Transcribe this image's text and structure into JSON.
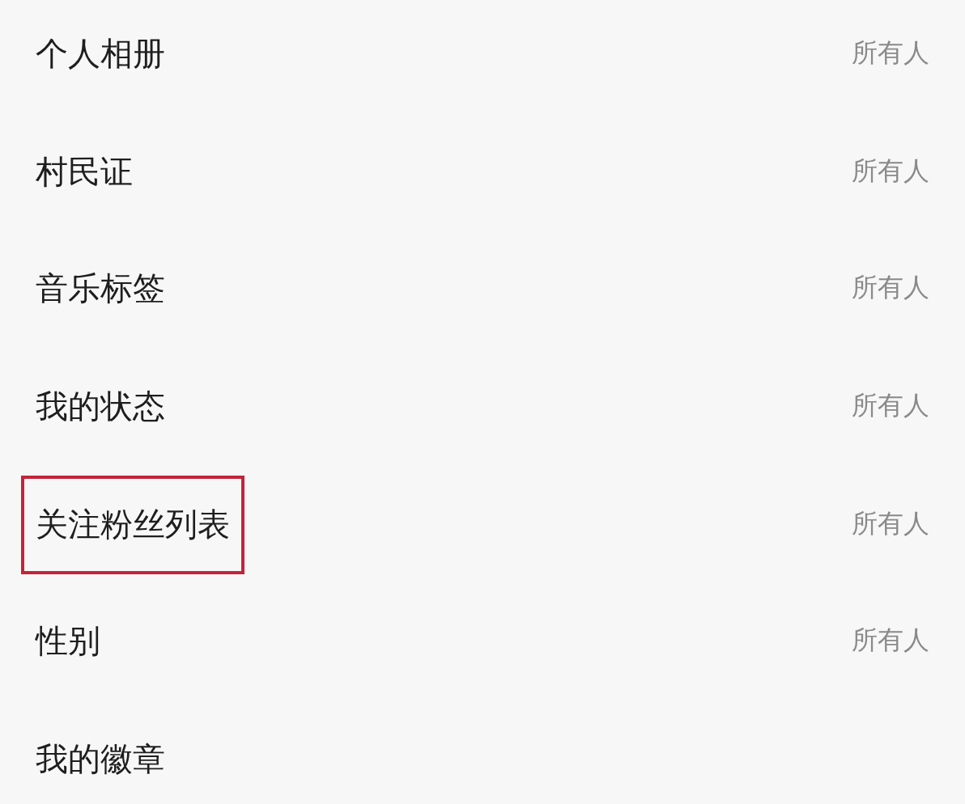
{
  "settings": [
    {
      "label": "个人相册",
      "value": "所有人",
      "highlighted": false
    },
    {
      "label": "村民证",
      "value": "所有人",
      "highlighted": false
    },
    {
      "label": "音乐标签",
      "value": "所有人",
      "highlighted": false
    },
    {
      "label": "我的状态",
      "value": "所有人",
      "highlighted": false
    },
    {
      "label": "关注粉丝列表",
      "value": "所有人",
      "highlighted": true
    },
    {
      "label": "性别",
      "value": "所有人",
      "highlighted": false
    },
    {
      "label": "我的徽章",
      "highlighted": false
    }
  ]
}
